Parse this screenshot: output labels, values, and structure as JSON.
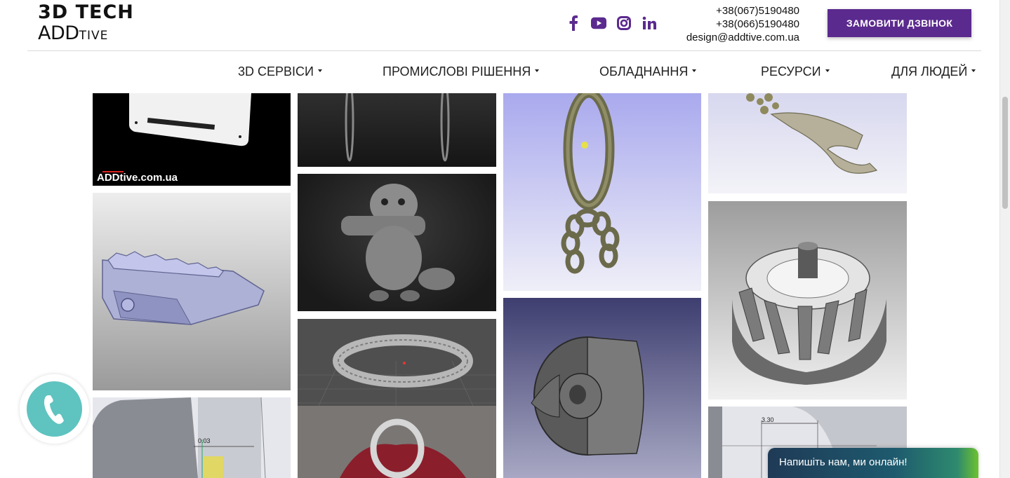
{
  "brand": {
    "logo_line1": "3D TECH",
    "logo_line2a": "ADD",
    "logo_line2b": "TIVE"
  },
  "header": {
    "phones": [
      "+38(067)5190480",
      "+38(066)5190480"
    ],
    "email": "design@addtive.com.ua",
    "cta_label": "ЗАМОВИТИ ДЗВІНОК",
    "social_icons": [
      "facebook-icon",
      "youtube-icon",
      "instagram-icon",
      "linkedin-icon"
    ]
  },
  "nav": {
    "items": [
      {
        "label": "3D СЕРВІСИ"
      },
      {
        "label": "ПРОМИСЛОВІ РІШЕННЯ"
      },
      {
        "label": "ОБЛАДНАННЯ"
      },
      {
        "label": "РЕСУРСИ"
      },
      {
        "label": "ДЛЯ ЛЮДЕЙ"
      }
    ]
  },
  "gallery": {
    "watermark": "ADDtive.com.ua",
    "dimension_label_1": "0.03",
    "dimension_label_2": "3.30"
  },
  "chat": {
    "label": "Напишіть нам, ми онлайн!"
  },
  "colors": {
    "accent": "#5b2a8e",
    "call": "#5fc3c0",
    "social": "#5b2a8e"
  }
}
